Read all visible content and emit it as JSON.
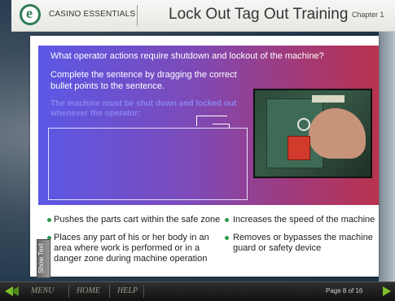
{
  "header": {
    "brand": "CASINO ESSENTIALS",
    "course_title": "Lock Out Tag Out Training",
    "chapter": "Chapter 1"
  },
  "question": "What operator actions require shutdown and lockout of the machine?",
  "instruction": "Complete the sentence by dragging the correct bullet points to the sentence.",
  "target_sentence": "The machine must be shut down and locked out whenever the operator:",
  "options": [
    {
      "label": "Pushes the parts cart within the safe zone"
    },
    {
      "label": "Increases the speed of the machine"
    },
    {
      "label": "Places any part of his or her body in an area where work is performed or in a danger zone during machine operation"
    },
    {
      "label": "Removes or bypasses the machine guard or safety device"
    }
  ],
  "show_text": "Show Text",
  "footer": {
    "menu": "MENU",
    "home": "HOME",
    "help": "HELP",
    "page": "Page 8 of 16"
  },
  "colors": {
    "accent_green": "#2f9a4d",
    "stage_start": "#5b58e6",
    "stage_end": "#b8324e"
  },
  "icons": [
    "back-arrow-icon",
    "next-arrow-icon",
    "logo-icon"
  ]
}
